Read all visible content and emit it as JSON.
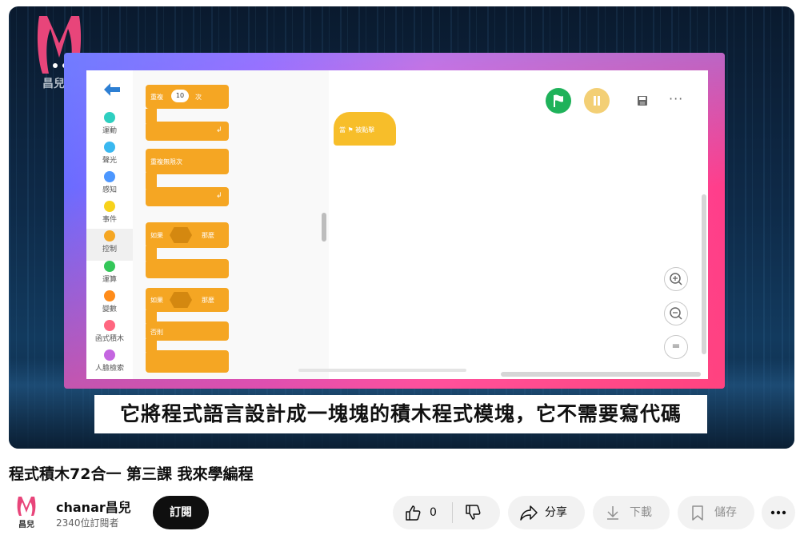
{
  "video": {
    "channel_logo_text": "昌兒",
    "subtitle": "它將程式語言設計成一塊塊的積木程式模塊，它不需要寫代碼"
  },
  "editor": {
    "categories": [
      {
        "label": "運動",
        "color": "#2ecfc0"
      },
      {
        "label": "聲光",
        "color": "#3ab8f0"
      },
      {
        "label": "感知",
        "color": "#4c97ff"
      },
      {
        "label": "事件",
        "color": "#f7d21b"
      },
      {
        "label": "控制",
        "color": "#f5a623"
      },
      {
        "label": "運算",
        "color": "#34c759"
      },
      {
        "label": "變數",
        "color": "#ff8c1a"
      },
      {
        "label": "函式積木",
        "color": "#ff6680"
      },
      {
        "label": "人臉檢索",
        "color": "#c466e0"
      }
    ],
    "blocks": {
      "repeat_label": "重複",
      "repeat_count": "10",
      "repeat_unit": "次",
      "forever_label": "重複無限次",
      "if_label": "如果",
      "if_then": "那麼",
      "if_else_label": "如果",
      "if_else_then": "那麼",
      "else_label": "否則"
    },
    "hat_block_text": "當 ⚑ 被點擊",
    "zoom_reset_symbol": "="
  },
  "video_title": "程式積木72合一 第三課 我來學編程",
  "channel": {
    "name": "chanar昌兒",
    "subscribers": "2340位訂閱者",
    "avatar_text": "昌兒"
  },
  "actions": {
    "subscribe": "訂閱",
    "like_count": "0",
    "share": "分享",
    "download": "下載",
    "save": "儲存"
  },
  "colors": {
    "block_orange": "#f5a623",
    "hat_yellow": "#f7be2a",
    "green_flag": "#1fb25a",
    "pause": "#f3cf75",
    "logo_pink": "#e8457a"
  }
}
